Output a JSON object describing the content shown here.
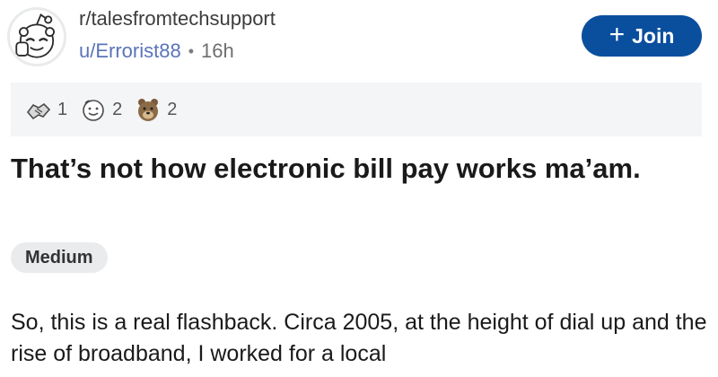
{
  "post": {
    "subreddit": "r/talesfromtechsupport",
    "author": "u/Errorist88",
    "separator": "•",
    "age": "16h",
    "join_label": "Join",
    "join_icon": "+",
    "awards": [
      {
        "icon": "handshake-award-icon",
        "count": "1"
      },
      {
        "icon": "wholesome-award-icon",
        "count": "2"
      },
      {
        "icon": "bear-award-icon",
        "count": "2"
      }
    ],
    "title": "That’s not how electronic bill pay works ma’am.",
    "flair": "Medium",
    "body_text": "So, this is a real flashback. Circa 2005, at the height of dial up and the rise of broadband, I worked for a local"
  },
  "colors": {
    "join_bg": "#0a4f9e",
    "username": "#5a74b8",
    "awards_bg": "#f4f5f6",
    "flair_bg": "#e9ebed"
  }
}
